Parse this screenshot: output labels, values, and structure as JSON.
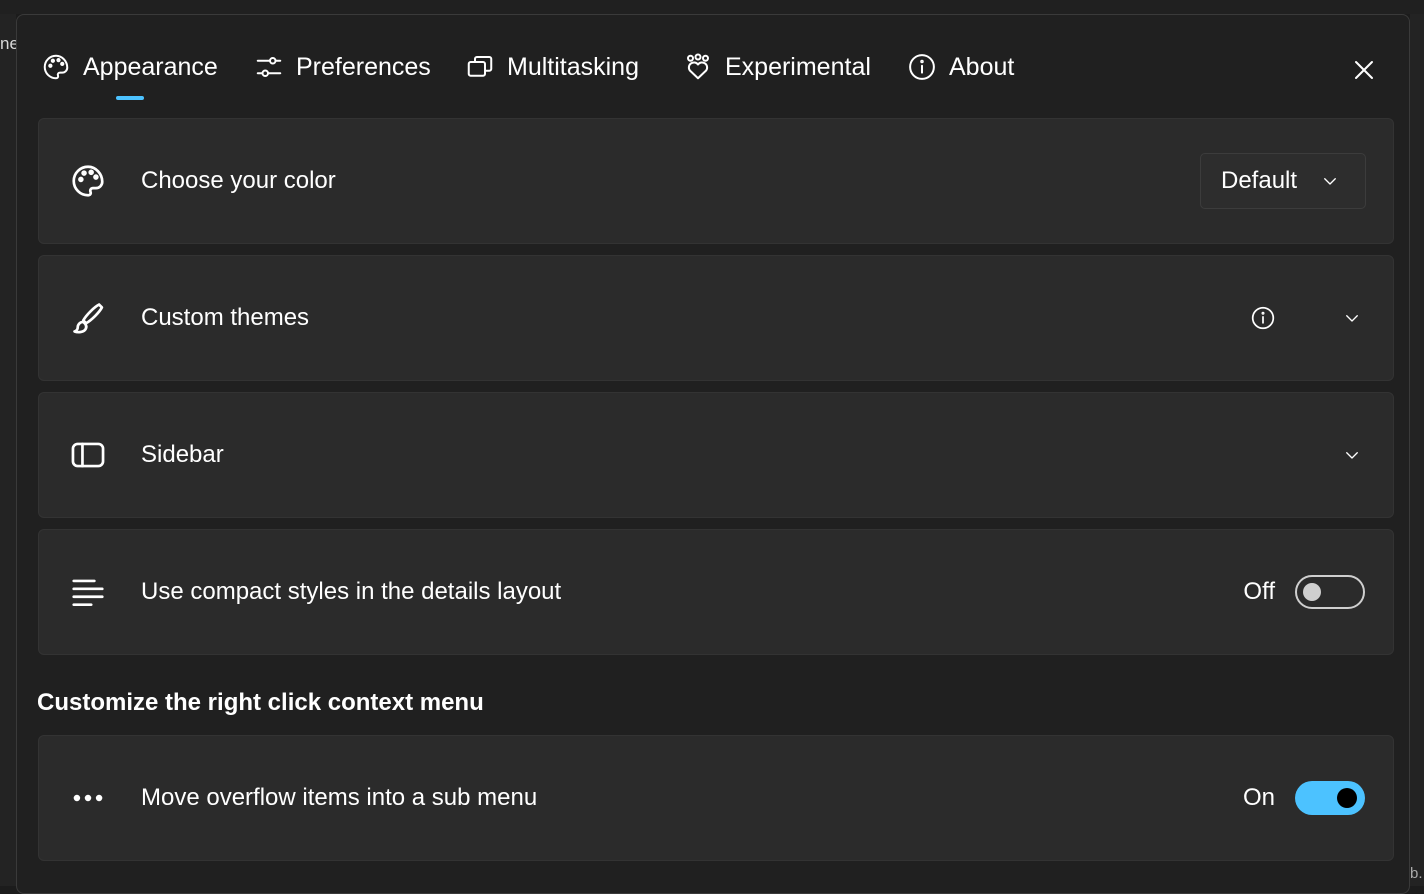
{
  "background": {
    "left_fragment": "ne",
    "right_fragment": "b."
  },
  "tabs": [
    {
      "label": "Appearance",
      "icon": "palette-icon",
      "selected": true
    },
    {
      "label": "Preferences",
      "icon": "sliders-icon",
      "selected": false
    },
    {
      "label": "Multitasking",
      "icon": "windows-stack-icon",
      "selected": false
    },
    {
      "label": "Experimental",
      "icon": "people-heart-icon",
      "selected": false
    },
    {
      "label": "About",
      "icon": "info-icon",
      "selected": false
    }
  ],
  "close": {
    "icon": "close-icon"
  },
  "settings": {
    "color": {
      "label": "Choose your color",
      "icon": "palette-icon",
      "value": "Default"
    },
    "themes": {
      "label": "Custom themes",
      "icon": "paintbrush-icon"
    },
    "sidebar": {
      "label": "Sidebar",
      "icon": "sidebar-panel-icon"
    },
    "compact": {
      "label": "Use compact styles in the details layout",
      "icon": "align-left-lines-icon",
      "state": "Off"
    }
  },
  "context_menu": {
    "heading": "Customize the right click context menu",
    "overflow": {
      "label": "Move overflow items into a sub menu",
      "icon": "more-dots-icon",
      "state": "On"
    }
  },
  "colors": {
    "accent": "#4cc2ff",
    "card": "#2b2b2b",
    "dialog": "#202020"
  }
}
